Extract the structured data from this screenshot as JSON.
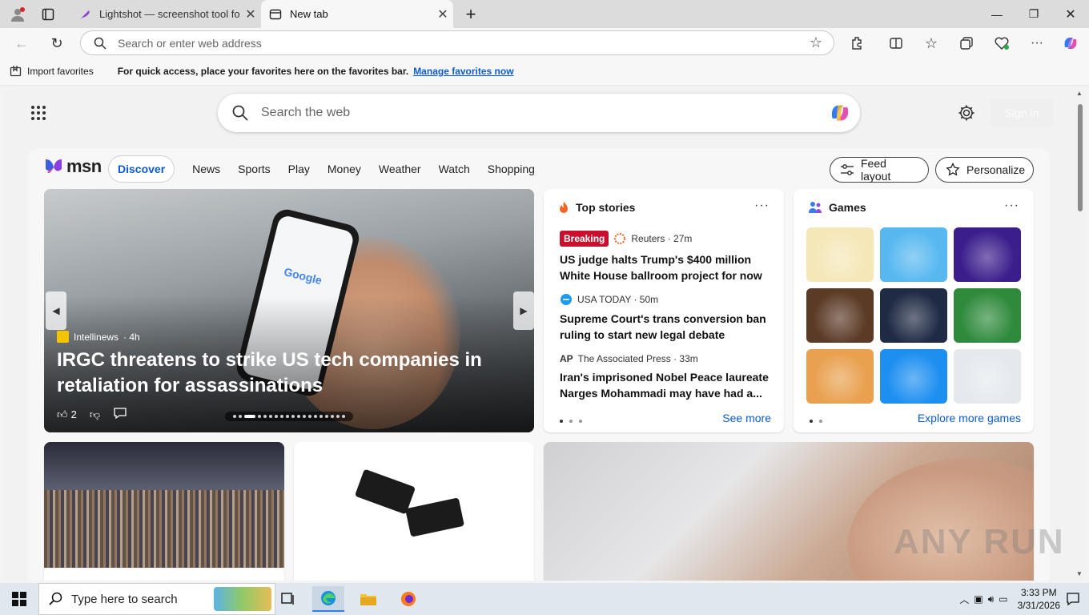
{
  "browser": {
    "tabs": [
      {
        "label": "Lightshot — screenshot tool for Mac & Win",
        "icon": "feather-icon"
      },
      {
        "label": "New tab",
        "icon": "newtab-icon"
      }
    ],
    "address_placeholder": "Search or enter web address"
  },
  "favorites_bar": {
    "import_label": "Import favorites",
    "message": "For quick access, place your favorites here on the favorites bar.",
    "link": "Manage favorites now"
  },
  "newtab": {
    "search_placeholder": "Search the web",
    "signin_label": "Sign in"
  },
  "msn": {
    "logo_text": "msn",
    "nav": [
      "Discover",
      "News",
      "Sports",
      "Play",
      "Money",
      "Weather",
      "Watch",
      "Shopping"
    ],
    "feed_layout_label": "Feed layout",
    "personalize_label": "Personalize",
    "hero": {
      "source": "Intellinews",
      "age": "· 4h",
      "title": "IRGC threatens to strike US tech companies in retaliation for assassinations",
      "likes": "2",
      "phone_text": "Google",
      "slide_count": 19,
      "active_slide": 3
    },
    "top_stories": {
      "title": "Top stories",
      "items": [
        {
          "badge": "Breaking",
          "source": "Reuters · 27m",
          "headline": "US judge halts Trump's $400 million White House ballroom project for now"
        },
        {
          "source": "USA TODAY · 50m",
          "headline": "Supreme Court's trans conversion ban ruling to start new legal debate"
        },
        {
          "source": "The Associated Press · 33m",
          "source_logo": "AP",
          "headline": "Iran's imprisoned Nobel Peace laureate Narges Mohammadi may have had a..."
        }
      ],
      "see_more": "See more"
    },
    "games": {
      "title": "Games",
      "explore": "Explore more games",
      "tile_colors": [
        "#f5e7b8",
        "#57b8f0",
        "#3b1e8c",
        "#5b3a26",
        "#1f2a44",
        "#2f8a3c",
        "#e9a04f",
        "#1d8ff0",
        "#e5e9ee"
      ]
    }
  },
  "taskbar": {
    "search_placeholder": "Type here to search",
    "time": "3:33 PM",
    "date": "3/31/2026"
  },
  "watermark": "ANY RUN"
}
